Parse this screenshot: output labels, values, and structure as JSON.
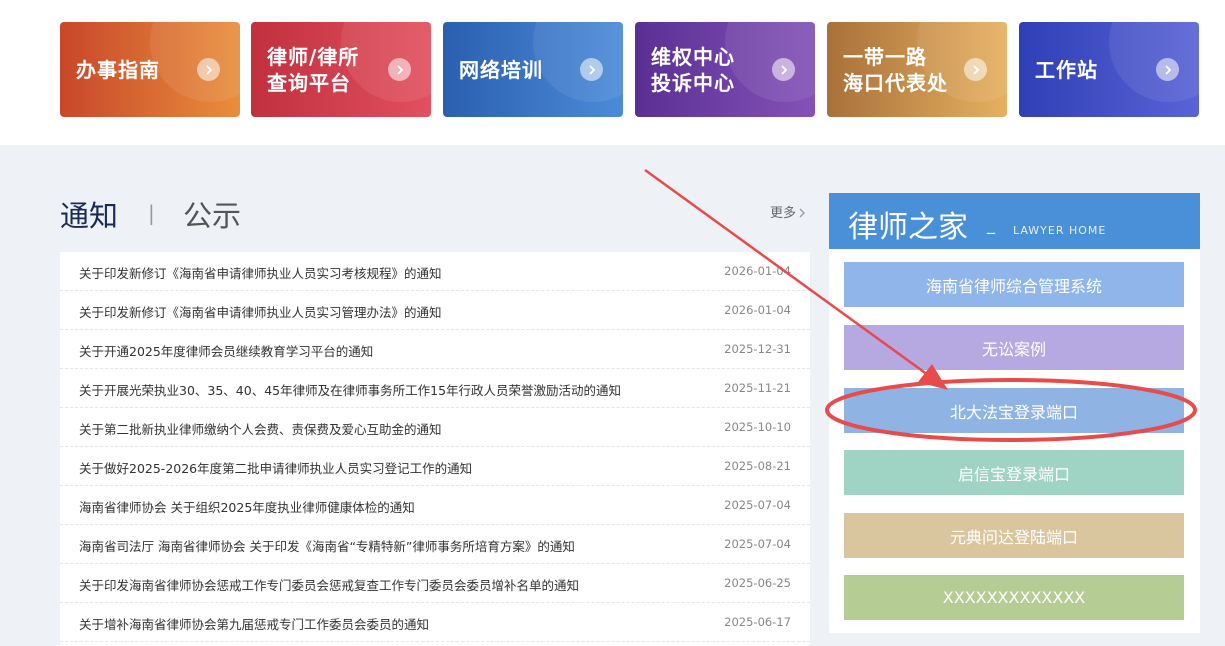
{
  "tiles": [
    {
      "label": "办事指南",
      "icon": "chevron-right-icon",
      "color_from": "#c8472a",
      "color_to": "#e98e3c"
    },
    {
      "label": "律师/律所\n查询平台",
      "icon": "chevron-right-icon",
      "color_from": "#c0303d",
      "color_to": "#e2505f"
    },
    {
      "label": "网络培训",
      "icon": "chevron-right-icon",
      "color_from": "#2b5fb0",
      "color_to": "#4b8bd8"
    },
    {
      "label": "维权中心\n投诉中心",
      "icon": "chevron-right-icon",
      "color_from": "#5a2f93",
      "color_to": "#8452b8"
    },
    {
      "label": "一带一路\n海口代表处",
      "icon": "chevron-right-icon",
      "color_from": "#a9713a",
      "color_to": "#e6b060"
    },
    {
      "label": "工作站",
      "icon": "chevron-right-icon",
      "color_from": "#2f3fb6",
      "color_to": "#5a63d6"
    }
  ],
  "notice": {
    "tab_active": "通知",
    "separator": "|",
    "tab_inactive": "公示",
    "more": "更多",
    "items": [
      {
        "title": "关于印发新修订《海南省申请律师执业人员实习考核规程》的通知",
        "date": "2026-01-04"
      },
      {
        "title": "关于印发新修订《海南省申请律师执业人员实习管理办法》的通知",
        "date": "2026-01-04"
      },
      {
        "title": "关于开通2025年度律师会员继续教育学习平台的通知",
        "date": "2025-12-31"
      },
      {
        "title": "关于开展光荣执业30、35、40、45年律师及在律师事务所工作15年行政人员荣誉激励活动的通知",
        "date": "2025-11-21"
      },
      {
        "title": "关于第二批新执业律师缴纳个人会费、责保费及爱心互助金的通知",
        "date": "2025-10-10"
      },
      {
        "title": "关于做好2025-2026年度第二批申请律师执业人员实习登记工作的通知",
        "date": "2025-08-21"
      },
      {
        "title": "海南省律师协会 关于组织2025年度执业律师健康体检的通知",
        "date": "2025-07-04"
      },
      {
        "title": "海南省司法厅 海南省律师协会 关于印发《海南省“专精特新”律师事务所培育方案》的通知",
        "date": "2025-07-04"
      },
      {
        "title": "关于印发海南省律师协会惩戒工作专门委员会惩戒复查工作专门委员会委员增补名单的通知",
        "date": "2025-06-25"
      },
      {
        "title": "关于增补海南省律师协会第九届惩戒专门工作委员会委员的通知",
        "date": "2025-06-17"
      }
    ]
  },
  "home": {
    "title": "律师之家",
    "dash": "_",
    "subtitle": "LAWYER HOME",
    "header_color": "#4a90d9",
    "buttons": [
      {
        "label": "海南省律师综合管理系统",
        "color": "#8fb5ea"
      },
      {
        "label": "无讼案例",
        "color": "#b6a8e0"
      },
      {
        "label": "北大法宝登录端口",
        "color": "#8fb3e3"
      },
      {
        "label": "启信宝登录端口",
        "color": "#9fd4c5"
      },
      {
        "label": "元典问达登陆端口",
        "color": "#d9c59e"
      },
      {
        "label": "XXXXXXXXXXXXX",
        "color": "#b5cc95"
      }
    ]
  },
  "annotation": {
    "color": "#e84b4b"
  }
}
